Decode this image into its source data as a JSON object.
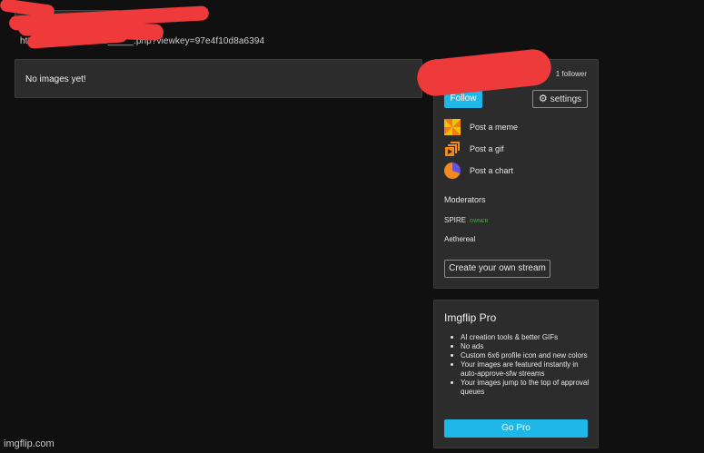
{
  "header": {
    "url_text": "https://imgflip.com/m/_____.php?viewkey=97e4f10d8a6394"
  },
  "main": {
    "empty_message": "No images yet!"
  },
  "stream_panel": {
    "follower_count": "1 follower",
    "follow_label": "Follow",
    "settings_label": "settings",
    "post_items": [
      {
        "label": "Post a meme",
        "icon": "meme-icon"
      },
      {
        "label": "Post a gif",
        "icon": "gif-icon"
      },
      {
        "label": "Post a chart",
        "icon": "chart-icon"
      }
    ],
    "moderators_title": "Moderators",
    "moderators": [
      {
        "name": "SPIRE",
        "badge": "OWNER"
      },
      {
        "name": "Aethereal",
        "badge": ""
      }
    ],
    "create_stream_label": "Create your own stream"
  },
  "pro_panel": {
    "title": "Imgflip Pro",
    "features": [
      "AI creation tools & better GIFs",
      "No ads",
      "Custom 6x6 profile icon and new colors",
      "Your images are featured instantly in auto-approve-sfw streams",
      "Your images jump to the top of approval queues"
    ],
    "cta_label": "Go Pro"
  },
  "watermark": "imgflip.com",
  "colors": {
    "accent": "#1fb7e8",
    "background": "#101010",
    "panel": "#2c2c2c",
    "owner_badge": "#4cbf4c",
    "redaction": "#ee3a3a"
  }
}
